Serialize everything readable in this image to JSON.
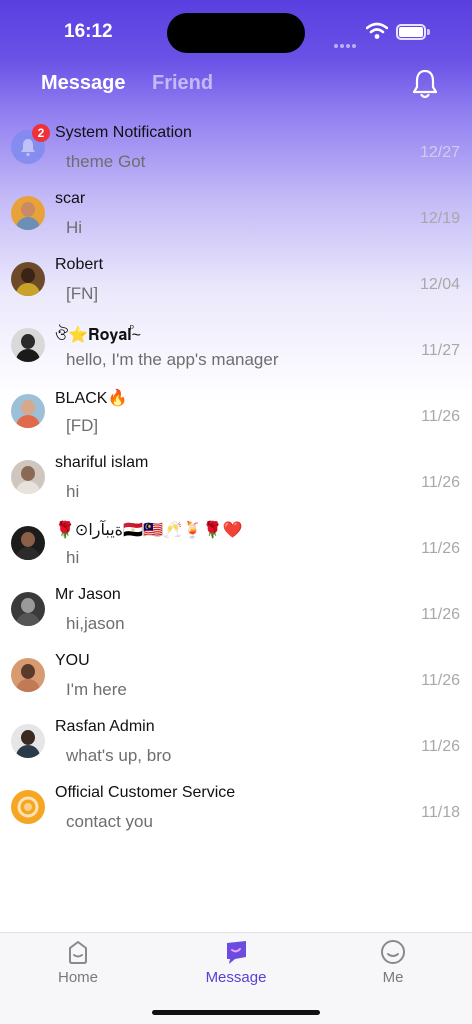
{
  "status_bar": {
    "time": "16:12"
  },
  "header": {
    "tabs": [
      {
        "label": "Message",
        "active": true
      },
      {
        "label": "Friend",
        "active": false
      }
    ],
    "notification_icon": "bell-icon"
  },
  "conversations": [
    {
      "name": "System Notification",
      "preview": "theme Got",
      "date": "12/27",
      "badge": "2",
      "avatar": "system-bell"
    },
    {
      "name": "scar",
      "preview": "Hi",
      "date": "12/19",
      "badge": null,
      "avatar": "photo"
    },
    {
      "name": "Robert",
      "preview": "[FN]",
      "date": "12/04",
      "badge": null,
      "avatar": "photo"
    },
    {
      "name": "ঔ⭐𝐑𝐨𝐲𝐚𝐥ⷬ~",
      "preview": "hello, I'm the app's manager",
      "date": "11/27",
      "badge": null,
      "avatar": "photo"
    },
    {
      "name": "BLACK🔥",
      "preview": "[FD]",
      "date": "11/26",
      "badge": null,
      "avatar": "photo"
    },
    {
      "name": "shariful islam",
      "preview": "hi",
      "date": "11/26",
      "badge": null,
      "avatar": "photo"
    },
    {
      "name": "🌹⊙ةيبآرا🇪🇬🇲🇾🥂🍹🌹❤️",
      "preview": "hi",
      "date": "11/26",
      "badge": null,
      "avatar": "photo"
    },
    {
      "name": "Mr Jason",
      "preview": "hi,jason",
      "date": "11/26",
      "badge": null,
      "avatar": "photo"
    },
    {
      "name": "YOU",
      "preview": "I'm here",
      "date": "11/26",
      "badge": null,
      "avatar": "photo"
    },
    {
      "name": "Rasfan Admin",
      "preview": "what's up, bro",
      "date": "11/26",
      "badge": null,
      "avatar": "photo"
    },
    {
      "name": "Official Customer Service",
      "preview": "contact you",
      "date": "11/18",
      "badge": null,
      "avatar": "service"
    }
  ],
  "tabbar": {
    "items": [
      {
        "label": "Home",
        "icon": "home-face-icon",
        "active": false
      },
      {
        "label": "Message",
        "icon": "message-icon",
        "active": true
      },
      {
        "label": "Me",
        "icon": "profile-face-icon",
        "active": false
      }
    ]
  },
  "colors": {
    "accent": "#5b3fd8",
    "badge": "#f0313a",
    "header_gradient_top": "#5a3fe0"
  }
}
